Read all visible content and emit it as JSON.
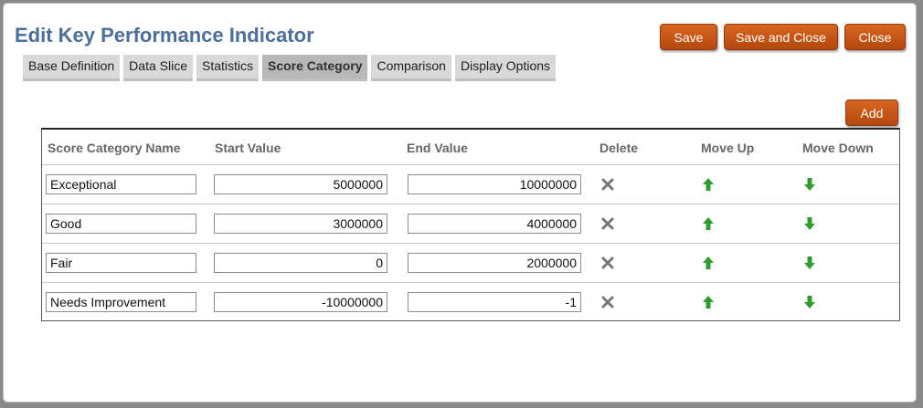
{
  "title": "Edit Key Performance Indicator",
  "buttons": {
    "save": "Save",
    "save_close": "Save and Close",
    "close": "Close",
    "add": "Add"
  },
  "tabs": [
    {
      "label": "Base Definition"
    },
    {
      "label": "Data Slice"
    },
    {
      "label": "Statistics"
    },
    {
      "label": "Score Category",
      "active": true
    },
    {
      "label": "Comparison"
    },
    {
      "label": "Display Options"
    }
  ],
  "columns": {
    "name": "Score Category Name",
    "start": "Start Value",
    "end": "End Value",
    "delete": "Delete",
    "move_up": "Move Up",
    "move_down": "Move Down"
  },
  "rows": [
    {
      "name": "Exceptional",
      "start": "5000000",
      "end": "10000000"
    },
    {
      "name": "Good",
      "start": "3000000",
      "end": "4000000"
    },
    {
      "name": "Fair",
      "start": "0",
      "end": "2000000"
    },
    {
      "name": "Needs Improvement",
      "start": "-10000000",
      "end": "-1"
    }
  ],
  "icons": {
    "delete": "close-x-icon",
    "move_up": "arrow-up-icon",
    "move_down": "arrow-down-icon"
  },
  "colors": {
    "title": "#4b6f98",
    "button": "#c85a1a",
    "arrow": "#2e9c2e",
    "delete": "#777777"
  }
}
